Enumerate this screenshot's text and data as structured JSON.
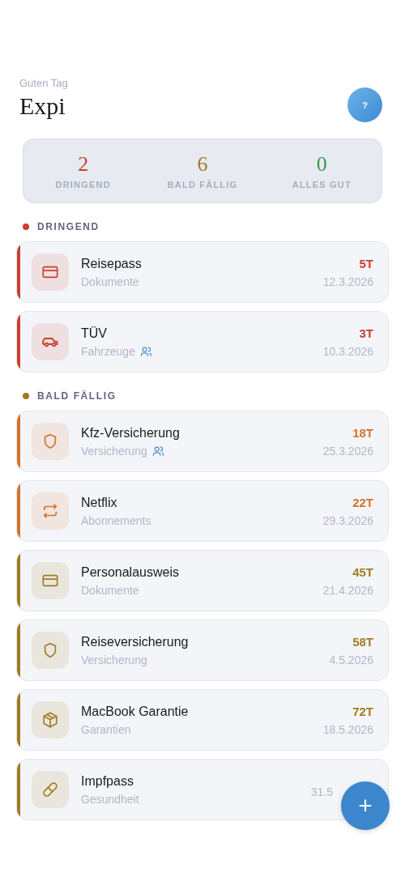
{
  "header": {
    "greeting": "Guten Tag",
    "title": "Expi",
    "help_button": "?"
  },
  "summary": [
    {
      "count": "2",
      "label": "DRINGEND",
      "color": "#c8402f"
    },
    {
      "count": "6",
      "label": "BALD FÄLLIG",
      "color": "#a07c22"
    },
    {
      "count": "0",
      "label": "ALLES GUT",
      "color": "#3f9a4a"
    }
  ],
  "sections": [
    {
      "label": "DRINGEND",
      "color": "#c8402f",
      "items": [
        {
          "name": "Reisepass",
          "category": "Dokumente",
          "shared": false,
          "days": "5T",
          "date": "12.3.2026",
          "kind": "card",
          "color": "#c8402f"
        },
        {
          "name": "TÜV",
          "category": "Fahrzeuge",
          "shared": true,
          "days": "3T",
          "date": "10.3.2026",
          "kind": "car",
          "color": "#c8402f"
        }
      ]
    },
    {
      "label": "BALD FÄLLIG",
      "color": "#a07c22",
      "items": [
        {
          "name": "Kfz-Versicherung",
          "category": "Versicherung",
          "shared": true,
          "days": "18T",
          "date": "25.3.2026",
          "kind": "shield",
          "color": "#d2732a"
        },
        {
          "name": "Netflix",
          "category": "Abonnements",
          "shared": false,
          "days": "22T",
          "date": "29.3.2026",
          "kind": "repeat",
          "color": "#d2732a"
        },
        {
          "name": "Personalausweis",
          "category": "Dokumente",
          "shared": false,
          "days": "45T",
          "date": "21.4.2026",
          "kind": "card",
          "color": "#a07c22"
        },
        {
          "name": "Reiseversicherung",
          "category": "Versicherung",
          "shared": false,
          "days": "58T",
          "date": "4.5.2026",
          "kind": "shield",
          "color": "#a07c22"
        },
        {
          "name": "MacBook Garantie",
          "category": "Garantien",
          "shared": false,
          "days": "72T",
          "date": "18.5.2026",
          "kind": "box",
          "color": "#a07c22"
        },
        {
          "name": "Impfpass",
          "category": "Gesundheit",
          "shared": false,
          "date": "31.5",
          "kind": "pill",
          "color": "#a07c22"
        }
      ]
    }
  ],
  "fab": "+"
}
